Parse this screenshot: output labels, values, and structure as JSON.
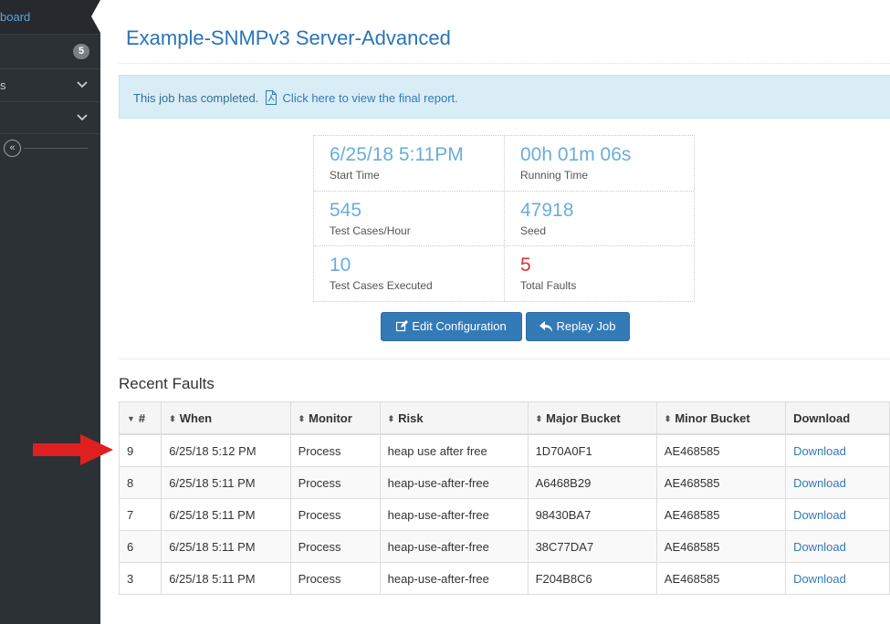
{
  "sidebar": {
    "dashboard_label": "board",
    "item1_badge": "5",
    "item2_label": "s",
    "collapse_glyph": "«"
  },
  "page": {
    "title": "Example-SNMPv3 Server-Advanced"
  },
  "alert": {
    "text": "This job has completed.",
    "link_text": "Click here to view the final report.",
    "icon": "pdf-file-icon"
  },
  "stats": {
    "start_time": {
      "value": "6/25/18 5:11PM",
      "label": "Start Time"
    },
    "running_time": {
      "value": "00h 01m 06s",
      "label": "Running Time"
    },
    "test_cases_hour": {
      "value": "545",
      "label": "Test Cases/Hour"
    },
    "seed": {
      "value": "47918",
      "label": "Seed"
    },
    "test_cases_executed": {
      "value": "10",
      "label": "Test Cases Executed"
    },
    "total_faults": {
      "value": "5",
      "label": "Total Faults",
      "color": "#d9322f"
    }
  },
  "buttons": {
    "edit_configuration": "Edit Configuration",
    "replay_job": "Replay Job"
  },
  "faults": {
    "title": "Recent Faults",
    "columns": [
      "#",
      "When",
      "Monitor",
      "Risk",
      "Major Bucket",
      "Minor Bucket",
      "Download"
    ],
    "rows": [
      {
        "num": "9",
        "when": "6/25/18 5:12 PM",
        "monitor": "Process",
        "risk": "heap use after free",
        "major": "1D70A0F1",
        "minor": "AE468585",
        "download": "Download"
      },
      {
        "num": "8",
        "when": "6/25/18 5:11 PM",
        "monitor": "Process",
        "risk": "heap-use-after-free",
        "major": "A6468B29",
        "minor": "AE468585",
        "download": "Download"
      },
      {
        "num": "7",
        "when": "6/25/18 5:11 PM",
        "monitor": "Process",
        "risk": "heap-use-after-free",
        "major": "98430BA7",
        "minor": "AE468585",
        "download": "Download"
      },
      {
        "num": "6",
        "when": "6/25/18 5:11 PM",
        "monitor": "Process",
        "risk": "heap-use-after-free",
        "major": "38C77DA7",
        "minor": "AE468585",
        "download": "Download"
      },
      {
        "num": "3",
        "when": "6/25/18 5:11 PM",
        "monitor": "Process",
        "risk": "heap-use-after-free",
        "major": "F204B8C6",
        "minor": "AE468585",
        "download": "Download"
      }
    ]
  },
  "colors": {
    "accent": "#337ab7",
    "sidebar_bg": "#2c3136",
    "annotation_arrow": "#e02020"
  }
}
